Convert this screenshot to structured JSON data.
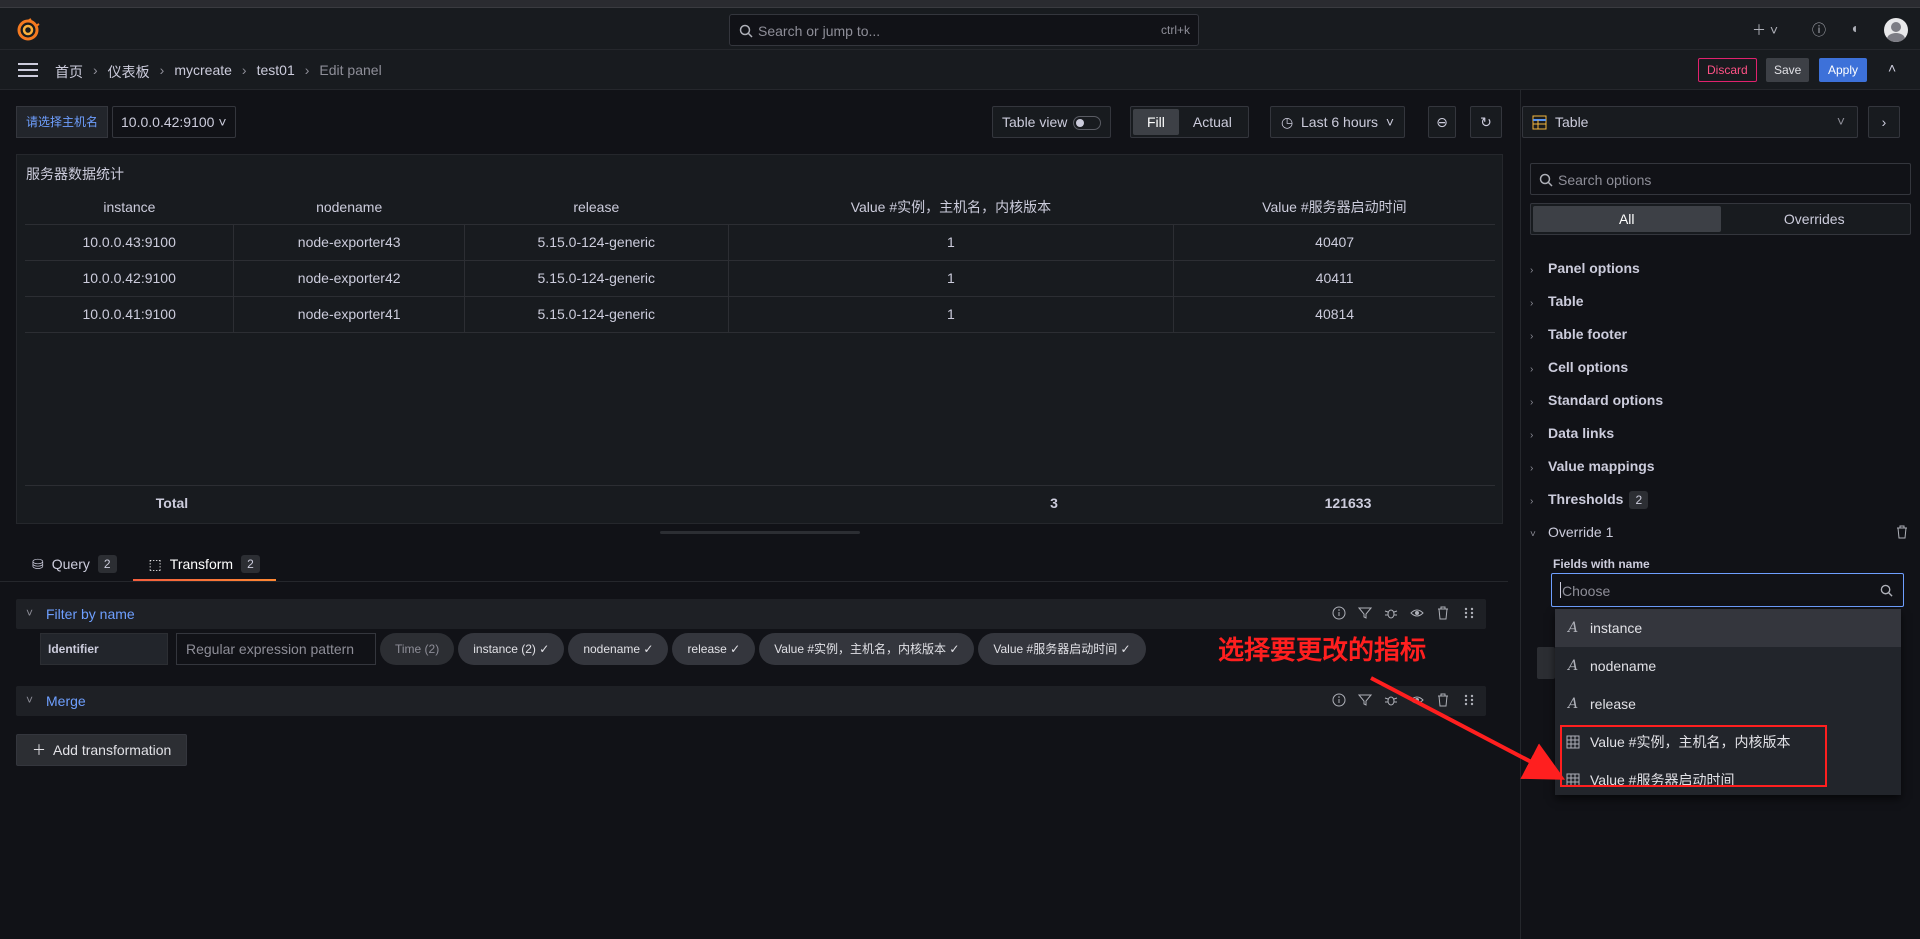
{
  "topbar": {
    "search_placeholder": "Search or jump to...",
    "search_shortcut": "ctrl+k"
  },
  "navbar": {
    "breadcrumbs": [
      "首页",
      "仪表板",
      "mycreate",
      "test01",
      "Edit panel"
    ],
    "discard_label": "Discard",
    "save_label": "Save",
    "apply_label": "Apply"
  },
  "variables": {
    "label": "请选择主机名",
    "value": "10.0.0.42:9100"
  },
  "toolbar": {
    "table_view_label": "Table view",
    "fill_label": "Fill",
    "actual_label": "Actual",
    "time_range": "Last 6 hours"
  },
  "panel": {
    "title": "服务器数据统计",
    "columns": [
      "instance",
      "nodename",
      "release",
      "Value #实例，主机名，内核版本",
      "Value #服务器启动时间"
    ],
    "rows": [
      [
        "10.0.0.43:9100",
        "node-exporter43",
        "5.15.0-124-generic",
        "1",
        "40407"
      ],
      [
        "10.0.0.42:9100",
        "node-exporter42",
        "5.15.0-124-generic",
        "1",
        "40411"
      ],
      [
        "10.0.0.41:9100",
        "node-exporter41",
        "5.15.0-124-generic",
        "1",
        "40814"
      ]
    ],
    "footer": [
      "Total",
      "",
      "",
      "3",
      "121633"
    ]
  },
  "tabs": [
    {
      "label": "Query",
      "count": "2"
    },
    {
      "label": "Transform",
      "count": "2"
    }
  ],
  "transforms": {
    "filter": {
      "title": "Filter by name",
      "identifier_label": "Identifier",
      "regex_placeholder": "Regular expression pattern",
      "chips": [
        "Time (2)",
        "instance (2) ✓",
        "nodename ✓",
        "release ✓",
        "Value #实例，主机名，内核版本 ✓",
        "Value #服务器启动时间 ✓"
      ]
    },
    "merge": {
      "title": "Merge"
    },
    "add_label": "Add transformation"
  },
  "annotation": "选择要更改的指标",
  "sidebar": {
    "viz_type": "Table",
    "search_placeholder": "Search options",
    "seg_all": "All",
    "seg_overrides": "Overrides",
    "sections": [
      "Panel options",
      "Table",
      "Table footer",
      "Cell options",
      "Standard options",
      "Data links",
      "Value mappings",
      "Thresholds"
    ],
    "thresholds_count": "2",
    "override_title": "Override 1",
    "fields_with_name": "Fields with name",
    "choose_placeholder": "Choose",
    "menu_items": [
      "instance",
      "nodename",
      "release",
      "Value #实例，主机名，内核版本",
      "Value #服务器启动时间"
    ]
  },
  "colors": {
    "accent_blue": "#3d71d9",
    "annotation_red": "#ff1f1f",
    "tab_underline": "#f55f3e"
  }
}
